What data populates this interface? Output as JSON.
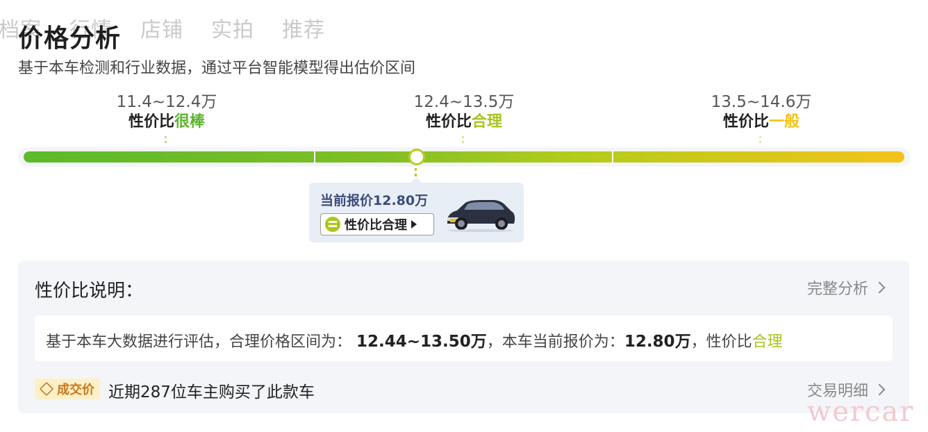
{
  "tabs": [
    "档案",
    "行情",
    "店铺",
    "实拍",
    "推荐"
  ],
  "header": {
    "title": "价格分析",
    "subtitle": "基于本车检测和行业数据，通过平台智能模型得出估价区间"
  },
  "ranges": [
    {
      "price": "11.4~12.4万",
      "verdict_prefix": "性价比",
      "verdict": "很棒",
      "color": "#5bb52b"
    },
    {
      "price": "12.4~13.5万",
      "verdict_prefix": "性价比",
      "verdict": "合理",
      "color": "#a7c51b"
    },
    {
      "price": "13.5~14.6万",
      "verdict_prefix": "性价比",
      "verdict": "一般",
      "color": "#f0c31a"
    }
  ],
  "current": {
    "price_label": "当前报价12.80万",
    "button_label": "性价比合理",
    "position_fraction": 0.447
  },
  "explanation": {
    "title": "性价比说明：",
    "link": "完整分析",
    "text_1": "基于本车大数据进行评估，合理价格区间为：",
    "range": "12.44~13.50万",
    "text_2": "，本车当前报价为：",
    "price": "12.80万",
    "text_3": "，性价比",
    "verdict": "合理"
  },
  "deal": {
    "badge": "成交价",
    "text": "近期287位车主购买了此款车",
    "link": "交易明细"
  },
  "watermark": "wercar"
}
